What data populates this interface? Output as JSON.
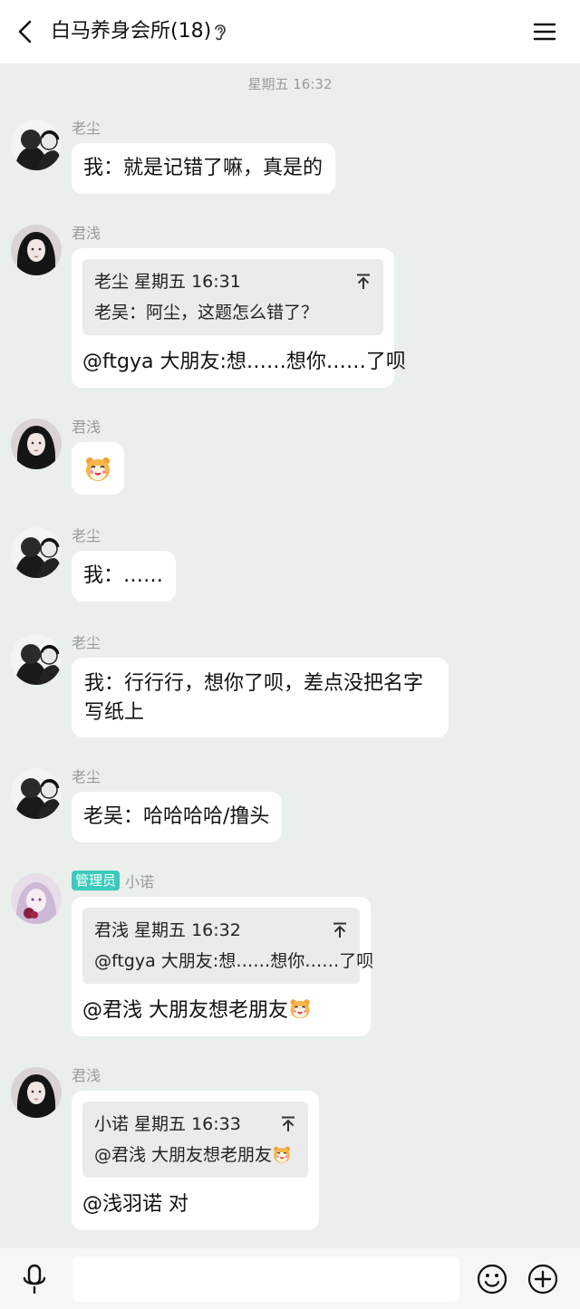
{
  "header": {
    "title": "白马养身会所(18)",
    "back_icon": "chevron-left-icon",
    "ear_icon": "ear-icon",
    "menu_icon": "hamburger-menu-icon"
  },
  "chat": {
    "time_separator": "星期五 16:32",
    "messages": [
      {
        "sender": "老尘",
        "text": "我：就是记错了嘛，真是的"
      },
      {
        "sender": "君浅",
        "quote_header": "老尘 星期五 16:31",
        "quote_text": "老吴：阿尘，这题怎么错了？",
        "text": "@ftgya 大朋友:想……想你……了呗"
      },
      {
        "sender": "君浅",
        "sticker": "hamster-emoji"
      },
      {
        "sender": "老尘",
        "text": "我：……"
      },
      {
        "sender": "老尘",
        "text": "我：行行行，想你了呗，差点没把名字写纸上"
      },
      {
        "sender": "老尘",
        "text": "老吴：哈哈哈哈/撸头"
      },
      {
        "badge": "管理员",
        "sender": "小诺",
        "quote_header": "君浅 星期五 16:32",
        "quote_text": "@ftgya 大朋友:想……想你……了呗",
        "text": "@君浅 大朋友想老朋友"
      },
      {
        "sender": "君浅",
        "quote_header": "小诺 星期五 16:33",
        "quote_text": "@君浅 大朋友想老朋友",
        "text": "@浅羽诺 对"
      }
    ]
  },
  "inputbar": {
    "mic_icon": "microphone-icon",
    "input_value": "",
    "smile_icon": "smiley-icon",
    "plus_icon": "plus-circle-icon"
  },
  "colors": {
    "chat_background": "#eaefec",
    "bubble": "#ffffff",
    "quote": "#ebebeb",
    "admin_badge": "#3ccabb"
  }
}
